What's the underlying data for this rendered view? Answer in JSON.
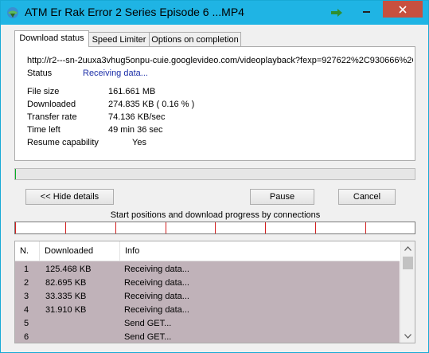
{
  "window": {
    "title": "ATM Er Rak Error 2 Series Episode 6 ...MP4"
  },
  "tabs": [
    {
      "label": "Download status",
      "active": true
    },
    {
      "label": "Speed Limiter",
      "active": false
    },
    {
      "label": "Options on completion",
      "active": false
    }
  ],
  "status_panel": {
    "url": "http://r2---sn-2uuxa3vhug5onpu-cuie.googlevideo.com/videoplayback?fexp=927622%2C930666%2C",
    "status_label": "Status",
    "status_value": "Receiving data...",
    "file_size_label": "File size",
    "file_size_value": "161.661  MB",
    "downloaded_label": "Downloaded",
    "downloaded_value": "274.835  KB  ( 0.16 % )",
    "transfer_rate_label": "Transfer rate",
    "transfer_rate_value": "74.136  KB/sec",
    "time_left_label": "Time left",
    "time_left_value": "49 min 36 sec",
    "resume_label": "Resume capability",
    "resume_value": "Yes"
  },
  "progress": {
    "fraction": 0.0016
  },
  "buttons": {
    "hide_details": "<< Hide details",
    "pause": "Pause",
    "cancel": "Cancel"
  },
  "connections": {
    "caption": "Start positions and download progress by connections"
  },
  "list": {
    "headers": [
      "N.",
      "Downloaded",
      "Info"
    ],
    "rows": [
      {
        "n": "1",
        "downloaded": "125.468  KB",
        "info": "Receiving data..."
      },
      {
        "n": "2",
        "downloaded": "82.695  KB",
        "info": "Receiving data..."
      },
      {
        "n": "3",
        "downloaded": "33.335  KB",
        "info": "Receiving data..."
      },
      {
        "n": "4",
        "downloaded": "31.910  KB",
        "info": "Receiving data..."
      },
      {
        "n": "5",
        "downloaded": "",
        "info": "Send GET..."
      },
      {
        "n": "6",
        "downloaded": "",
        "info": "Send GET..."
      }
    ]
  },
  "colors": {
    "titlebar": "#1fb4e4",
    "close_button": "#c7503f",
    "status_value": "#1c2fa8",
    "connection_tick": "#d42020",
    "list_rows_bg": "#c0b2b9"
  },
  "icons": {
    "app": "idm-globe-icon",
    "system_menu": "green-arrow-icon",
    "minimize": "minimize-icon",
    "close": "close-icon",
    "scroll_up": "chevron-up-icon",
    "scroll_down": "chevron-down-icon"
  }
}
